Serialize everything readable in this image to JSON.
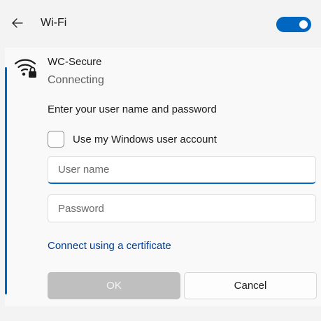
{
  "header": {
    "back_icon": "back-arrow-icon",
    "title": "Wi-Fi",
    "toggle_state": "on"
  },
  "network": {
    "icon": "wifi-secured-icon",
    "name": "WC-Secure",
    "status": "Connecting"
  },
  "form": {
    "prompt": "Enter your user name and password",
    "checkbox_label": "Use my Windows user account",
    "checkbox_checked": false,
    "username_placeholder": "User name",
    "password_placeholder": "Password",
    "certificate_link": "Connect using a certificate",
    "ok_label": "OK",
    "cancel_label": "Cancel"
  },
  "colors": {
    "accent": "#0067c0",
    "link": "#003e92",
    "disabled_button": "#bfbfbf"
  }
}
